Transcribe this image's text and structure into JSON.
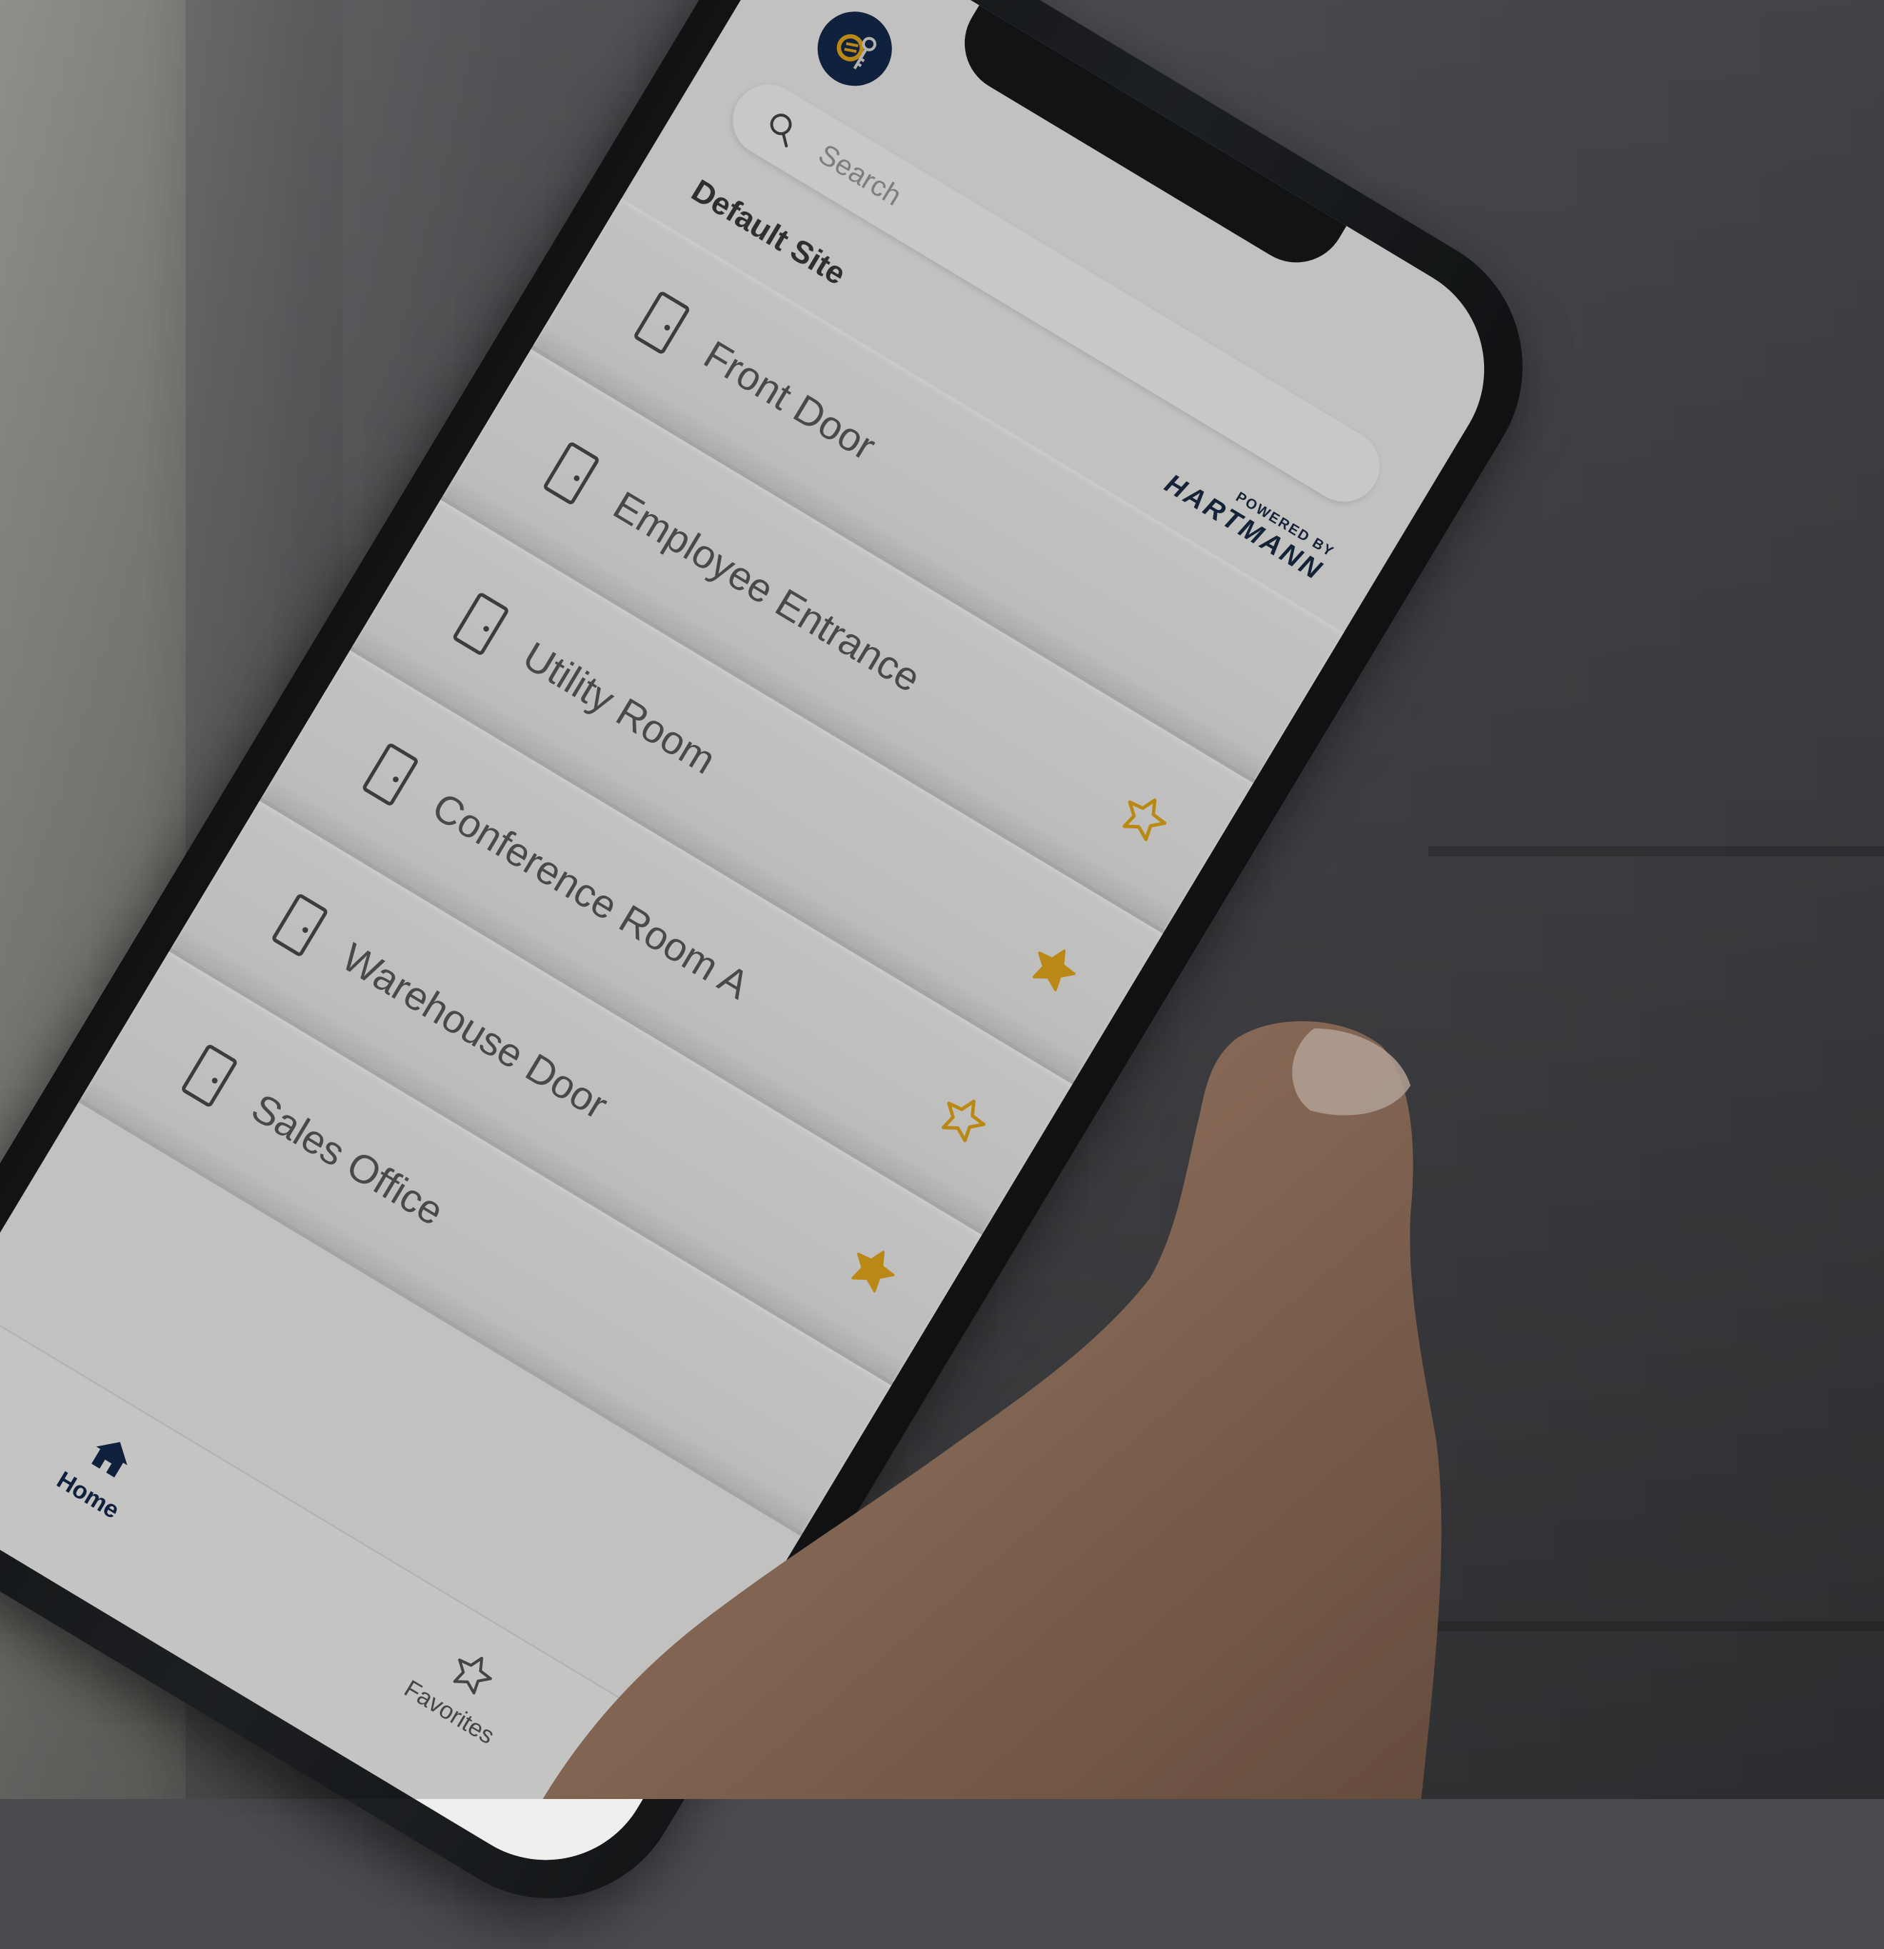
{
  "colors": {
    "brand_navy": "#13294b",
    "accent_gold": "#e3a81a",
    "screen_bg": "#ececeb",
    "label_gray": "#5a5a5a"
  },
  "header": {
    "logo_icon": "key-logo-icon",
    "search": {
      "icon": "search-icon",
      "placeholder": "Search"
    },
    "site_title": "Default Site",
    "powered_by": {
      "small_text": "POWERED BY",
      "brand": "HARTMANN"
    }
  },
  "doors": [
    {
      "label": "Front Door",
      "icon": "door-icon",
      "favorite": null
    },
    {
      "label": "Employee Entrance",
      "icon": "door-icon",
      "favorite": false
    },
    {
      "label": "Utility Room",
      "icon": "door-icon",
      "favorite": true
    },
    {
      "label": "Conference Room A",
      "icon": "door-icon",
      "favorite": false
    },
    {
      "label": "Warehouse Door",
      "icon": "door-icon",
      "favorite": true
    },
    {
      "label": "Sales Office",
      "icon": "door-icon",
      "favorite": null
    }
  ],
  "bottom_nav": {
    "items": [
      {
        "label": "Home",
        "icon": "home-icon",
        "active": true
      },
      {
        "label": "Favorites",
        "icon": "star-outline-icon",
        "active": false
      }
    ]
  }
}
